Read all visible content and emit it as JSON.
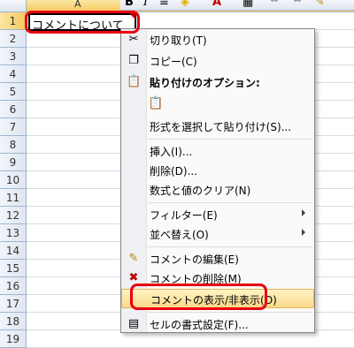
{
  "column_header": {
    "a": "A"
  },
  "rows": [
    "1",
    "2",
    "3",
    "4",
    "5",
    "6",
    "7",
    "8",
    "9",
    "10",
    "11",
    "12",
    "13",
    "14",
    "15",
    "16",
    "17",
    "18",
    "19"
  ],
  "cell_a1": {
    "value": "コメントについて"
  },
  "toolbar": {
    "bold": "B",
    "italic": "I",
    "font_color": "A",
    "percent": "%"
  },
  "context_menu": {
    "cut": "切り取り(T)",
    "copy": "コピー(C)",
    "paste_options": "貼り付けのオプション:",
    "paste_special": "形式を選択して貼り付け(S)...",
    "insert": "挿入(I)...",
    "delete": "削除(D)...",
    "clear_contents": "数式と値のクリア(N)",
    "filter": "フィルター(E)",
    "sort": "並べ替え(O)",
    "edit_comment": "コメントの編集(E)",
    "delete_comment": "コメントの削除(M)",
    "show_hide_comment": "コメントの表示/非表示(O)",
    "format_cells": "セルの書式設定(F)..."
  },
  "colors": {
    "highlight_outline": "#e8000f",
    "menu_hover": "#fbd98a"
  }
}
